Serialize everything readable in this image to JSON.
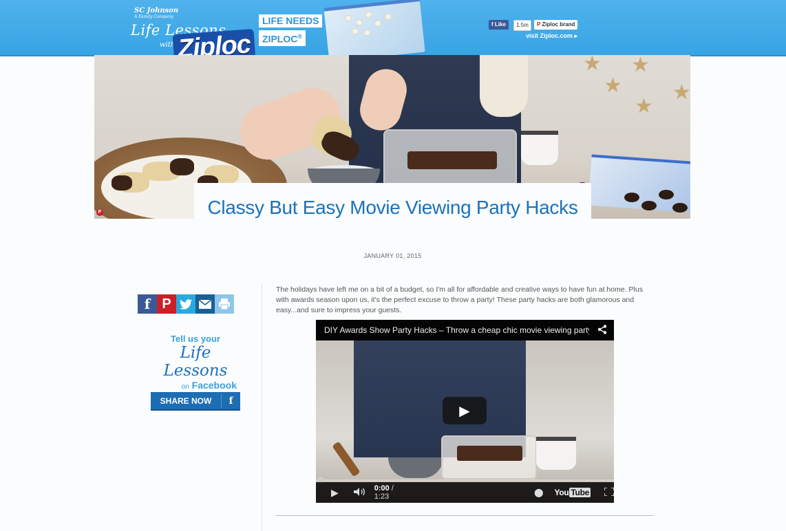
{
  "header": {
    "sc_brand": "SC Johnson",
    "sc_sub": "A Family Company",
    "life_lessons": "Life Lessons",
    "with": "with",
    "ziploc_logo": "Ziploc",
    "life_needs": "LIFE NEEDS",
    "ziploc_tag": "ZIPLOC",
    "registered": "®",
    "fb_like": "Like",
    "like_count": "1.5m",
    "pinterest_label": "Ziploc brand",
    "visit_link": "visit Ziploc.com",
    "visit_arrow": "▸"
  },
  "colors": {
    "header_blue": "#38a4e4",
    "title_blue": "#1d71b8",
    "facebook": "#3b5998",
    "pinterest": "#cb2027",
    "twitter": "#2aa9e0",
    "email": "#1a5f96",
    "print": "#8fc6ea"
  },
  "hero": {
    "pin_icon": "pinterest-icon"
  },
  "article": {
    "title": "Classy But Easy Movie Viewing Party Hacks",
    "date": "JANUARY 01, 2015",
    "intro": "The holidays have left me on a bit of a budget, so I'm all for affordable and creative ways to have fun at home. Plus with awards season upon us, it's the perfect excuse to throw a party! These party hacks are both glamorous and easy...and sure to impress your guests."
  },
  "share": {
    "icons": [
      "facebook-icon",
      "pinterest-icon",
      "twitter-icon",
      "email-icon",
      "print-icon"
    ],
    "fb_glyph": "f",
    "pin_glyph": "P"
  },
  "tellus": {
    "line1": "Tell us your",
    "line2": "Life Lessons",
    "line3_on": "on",
    "line3_fb": "Facebook",
    "share_now": "SHARE NOW",
    "share_f": "f"
  },
  "video": {
    "title": "DIY Awards Show Party Hacks – Throw a cheap chic movie viewing party",
    "current_time": "0:00",
    "separator": "/",
    "duration": "1:23",
    "youtube_you": "You",
    "youtube_tube": "Tube",
    "progress": 0
  }
}
